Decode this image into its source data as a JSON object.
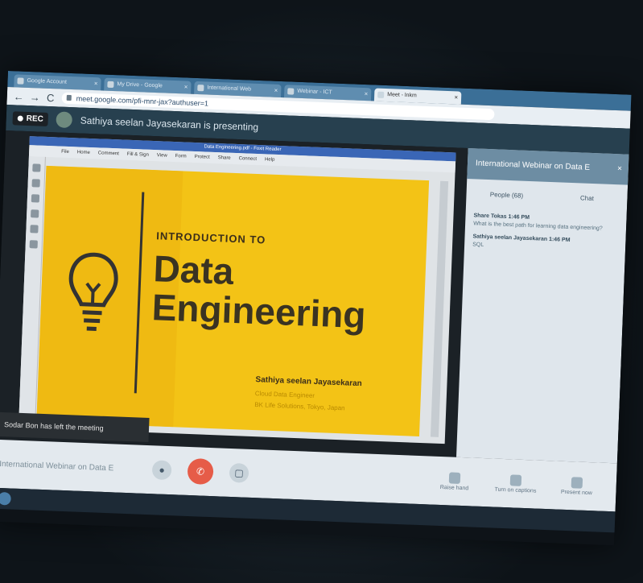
{
  "browser": {
    "tabs": [
      {
        "label": "Google Account",
        "active": false
      },
      {
        "label": "My Drive - Google",
        "active": false
      },
      {
        "label": "International Web",
        "active": false
      },
      {
        "label": "Webinar - ICT",
        "active": false
      },
      {
        "label": "Meet - lnkm",
        "active": true
      }
    ],
    "url": "meet.google.com/pfi-mnr-jax?authuser=1"
  },
  "meet": {
    "rec_label": "REC",
    "presenting_text": "Sathiya seelan Jayasekaran is presenting",
    "meeting_title": "International Webinar on Data E",
    "toast": "Sodar Bon has left the meeting",
    "side_panel": {
      "title": "International Webinar on Data E",
      "tab_people": "People (68)",
      "tab_chat": "Chat",
      "messages": [
        {
          "name": "Share Tokas 1:46 PM",
          "text": "What is the best path for learning data engineering?"
        },
        {
          "name": "Sathiya seelan Jayasekaran 1:46 PM",
          "text": "SQL"
        }
      ]
    },
    "controls": {
      "right": [
        "Raise hand",
        "Turn on captions",
        "Present now"
      ]
    }
  },
  "document": {
    "window_title": "Data Engineering.pdf - Foxit Reader",
    "menu": [
      "File",
      "Home",
      "Comment",
      "Fill & Sign",
      "View",
      "Form",
      "Protect",
      "Share",
      "Connect",
      "Help"
    ],
    "slide": {
      "kicker": "INTRODUCTION TO",
      "title_line1": "Data",
      "title_line2": "Engineering",
      "author": "Sathiya seelan Jayasekaran",
      "role": "Cloud Data Engineer",
      "affiliation": "BK Life Solutions, Tokyo, Japan"
    }
  }
}
